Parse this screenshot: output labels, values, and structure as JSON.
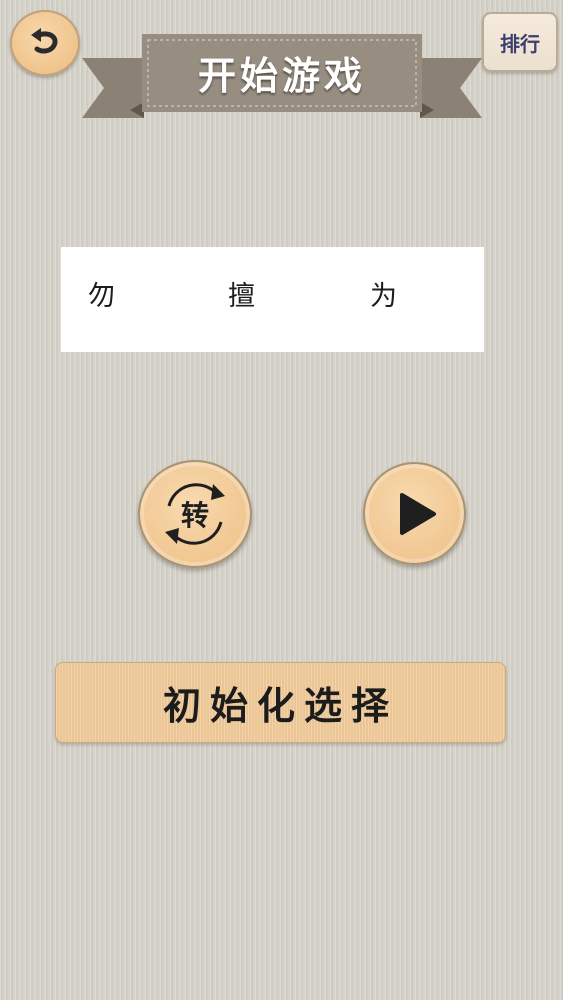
{
  "header": {
    "title": "开始游戏",
    "rank_label": "排行",
    "back_icon": "back-arrow-icon"
  },
  "word": {
    "chars": [
      "勿",
      "擅",
      "为"
    ]
  },
  "controls": {
    "rotate_label": "转",
    "rotate_icon": "rotate-icon",
    "play_icon": "play-icon"
  },
  "reset": {
    "label": "初始化选择"
  },
  "colors": {
    "background": "#d6d3ca",
    "button_fill": "#f1c690",
    "ribbon": "#8f8578",
    "rank_text": "#3c3e6e"
  }
}
